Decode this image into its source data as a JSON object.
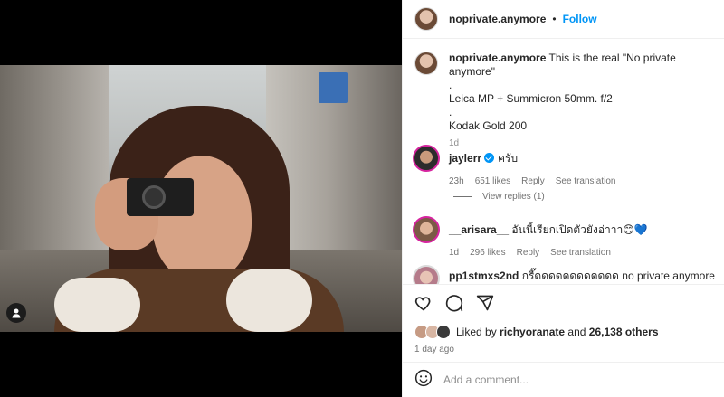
{
  "post": {
    "author": "noprivate.anymore",
    "follow_label": "Follow",
    "separator": "•"
  },
  "caption": {
    "username": "noprivate.anymore",
    "text_line1": "This is the real \"No private anymore\"",
    "dot1": ".",
    "line2": "Leica MP + Summicron 50mm. f/2",
    "dot2": ".",
    "line3": "Kodak Gold 200",
    "age": "1d"
  },
  "comments": [
    {
      "username": "jaylerr",
      "verified": true,
      "text": "ครับ",
      "age": "23h",
      "likes": "651 likes",
      "reply": "Reply",
      "translate": "See translation"
    },
    {
      "username": "__arisara__",
      "text": "อันนี้เรียกเปิดตัวยังอ่าาา😊💙",
      "age": "1d",
      "likes": "296 likes",
      "reply": "Reply",
      "translate": "See translation"
    },
    {
      "username": "pp1stmxs2nd",
      "text": "กรี๊ดดดดดดดดดดดด no private anymore"
    }
  ],
  "view_replies": "View replies (1)",
  "likes_line": {
    "prefix": "Liked by",
    "user": "richyoranate",
    "and": "and",
    "others": "26,138 others"
  },
  "posted_ago": "1 day ago",
  "add_comment": {
    "placeholder": "Add a comment..."
  },
  "icons": [
    "heart-icon",
    "comment-icon",
    "share-icon",
    "emoji-icon",
    "user-tag-icon",
    "verified-badge-icon"
  ],
  "colors": {
    "accent": "#0095f6",
    "text": "#262626",
    "muted": "#737373",
    "border": "#efefef",
    "story_ring": "#d6249f"
  }
}
